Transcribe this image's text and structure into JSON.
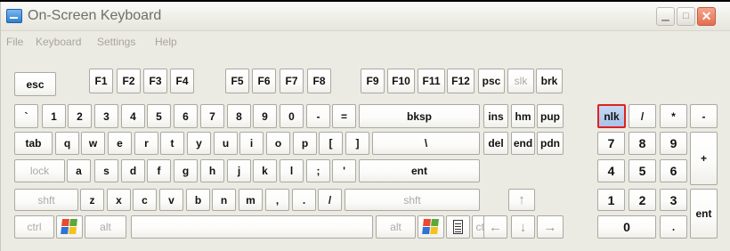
{
  "window": {
    "title": "On-Screen Keyboard"
  },
  "menu": [
    "File",
    "Keyboard",
    "Settings",
    "Help"
  ],
  "colors": {
    "selected_border": "#dd2222",
    "close_button": "#e56e4e",
    "key_face": "#ffffff"
  },
  "keys": [
    {
      "id": "esc",
      "label": "esc"
    },
    {
      "id": "f1",
      "label": "F1"
    },
    {
      "id": "f2",
      "label": "F2"
    },
    {
      "id": "f3",
      "label": "F3"
    },
    {
      "id": "f4",
      "label": "F4"
    },
    {
      "id": "f5",
      "label": "F5"
    },
    {
      "id": "f6",
      "label": "F6"
    },
    {
      "id": "f7",
      "label": "F7"
    },
    {
      "id": "f8",
      "label": "F8"
    },
    {
      "id": "f9",
      "label": "F9"
    },
    {
      "id": "f10",
      "label": "F10"
    },
    {
      "id": "f11",
      "label": "F11"
    },
    {
      "id": "f12",
      "label": "F12"
    },
    {
      "id": "psc",
      "label": "psc"
    },
    {
      "id": "slk",
      "label": "slk",
      "dim": true
    },
    {
      "id": "brk",
      "label": "brk"
    },
    {
      "id": "backtick",
      "label": "`"
    },
    {
      "id": "1",
      "label": "1"
    },
    {
      "id": "2",
      "label": "2"
    },
    {
      "id": "3",
      "label": "3"
    },
    {
      "id": "4",
      "label": "4"
    },
    {
      "id": "5",
      "label": "5"
    },
    {
      "id": "6",
      "label": "6"
    },
    {
      "id": "7",
      "label": "7"
    },
    {
      "id": "8",
      "label": "8"
    },
    {
      "id": "9",
      "label": "9"
    },
    {
      "id": "0",
      "label": "0"
    },
    {
      "id": "minus",
      "label": "-"
    },
    {
      "id": "equals",
      "label": "="
    },
    {
      "id": "bksp",
      "label": "bksp"
    },
    {
      "id": "ins",
      "label": "ins"
    },
    {
      "id": "hm",
      "label": "hm"
    },
    {
      "id": "pup",
      "label": "pup"
    },
    {
      "id": "nlk",
      "label": "nlk",
      "selected": true
    },
    {
      "id": "num-slash",
      "label": "/"
    },
    {
      "id": "num-star",
      "label": "*"
    },
    {
      "id": "num-minus",
      "label": "-"
    },
    {
      "id": "tab",
      "label": "tab"
    },
    {
      "id": "q",
      "label": "q"
    },
    {
      "id": "w",
      "label": "w"
    },
    {
      "id": "e",
      "label": "e"
    },
    {
      "id": "r",
      "label": "r"
    },
    {
      "id": "t",
      "label": "t"
    },
    {
      "id": "y",
      "label": "y"
    },
    {
      "id": "u",
      "label": "u"
    },
    {
      "id": "i",
      "label": "i"
    },
    {
      "id": "o",
      "label": "o"
    },
    {
      "id": "p",
      "label": "p"
    },
    {
      "id": "lbracket",
      "label": "["
    },
    {
      "id": "rbracket",
      "label": "]"
    },
    {
      "id": "backslash",
      "label": "\\"
    },
    {
      "id": "del",
      "label": "del"
    },
    {
      "id": "end",
      "label": "end"
    },
    {
      "id": "pdn",
      "label": "pdn"
    },
    {
      "id": "num7",
      "label": "7"
    },
    {
      "id": "num8",
      "label": "8"
    },
    {
      "id": "num9",
      "label": "9"
    },
    {
      "id": "num-plus",
      "label": "+"
    },
    {
      "id": "lock",
      "label": "lock",
      "dim": true
    },
    {
      "id": "a",
      "label": "a"
    },
    {
      "id": "s",
      "label": "s"
    },
    {
      "id": "d",
      "label": "d"
    },
    {
      "id": "f",
      "label": "f"
    },
    {
      "id": "g",
      "label": "g"
    },
    {
      "id": "h",
      "label": "h"
    },
    {
      "id": "j",
      "label": "j"
    },
    {
      "id": "k",
      "label": "k"
    },
    {
      "id": "l",
      "label": "l"
    },
    {
      "id": "semicolon",
      "label": ";"
    },
    {
      "id": "quote",
      "label": "'"
    },
    {
      "id": "ent",
      "label": "ent"
    },
    {
      "id": "num4",
      "label": "4"
    },
    {
      "id": "num5",
      "label": "5"
    },
    {
      "id": "num6",
      "label": "6"
    },
    {
      "id": "shft-left",
      "label": "shft",
      "dim": true
    },
    {
      "id": "z",
      "label": "z"
    },
    {
      "id": "x",
      "label": "x"
    },
    {
      "id": "c",
      "label": "c"
    },
    {
      "id": "v",
      "label": "v"
    },
    {
      "id": "b",
      "label": "b"
    },
    {
      "id": "n",
      "label": "n"
    },
    {
      "id": "m",
      "label": "m"
    },
    {
      "id": "comma",
      "label": ","
    },
    {
      "id": "period",
      "label": "."
    },
    {
      "id": "slash",
      "label": "/"
    },
    {
      "id": "shft-right",
      "label": "shft",
      "dim": true
    },
    {
      "id": "arrow-up",
      "label": "↑",
      "arrow": true
    },
    {
      "id": "num1",
      "label": "1"
    },
    {
      "id": "num2",
      "label": "2"
    },
    {
      "id": "num3",
      "label": "3"
    },
    {
      "id": "num-ent",
      "label": "ent"
    },
    {
      "id": "ctrl-left",
      "label": "ctrl",
      "dim": true
    },
    {
      "id": "win-left",
      "label": "",
      "icon": "windows-logo-icon"
    },
    {
      "id": "alt-left",
      "label": "alt",
      "dim": true
    },
    {
      "id": "space",
      "label": ""
    },
    {
      "id": "alt-right",
      "label": "alt",
      "dim": true
    },
    {
      "id": "win-right",
      "label": "",
      "icon": "windows-logo-icon"
    },
    {
      "id": "app-menu",
      "label": "",
      "icon": "context-menu-icon"
    },
    {
      "id": "ctrl-right",
      "label": "ctrl",
      "dim": true
    },
    {
      "id": "arrow-left",
      "label": "←",
      "arrow": true
    },
    {
      "id": "arrow-down",
      "label": "↓",
      "arrow": true
    },
    {
      "id": "arrow-right",
      "label": "→",
      "arrow": true
    },
    {
      "id": "num0",
      "label": "0"
    },
    {
      "id": "num-dot",
      "label": "."
    }
  ]
}
